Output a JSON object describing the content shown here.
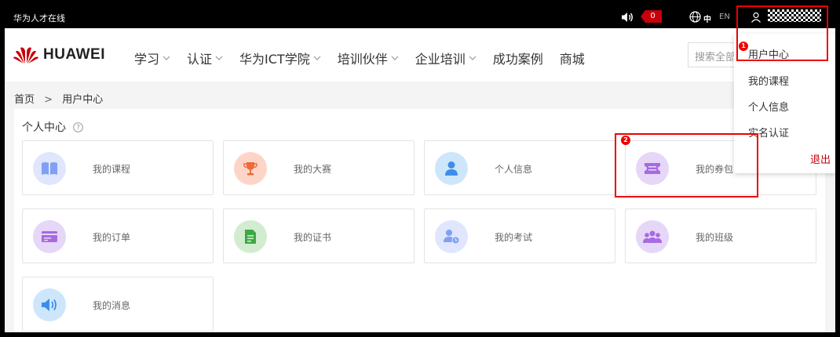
{
  "topbar": {
    "site_name": "华为人才在线",
    "notification_count": "0",
    "lang_zh": "中",
    "lang_en": "EN"
  },
  "header": {
    "logo_text": "HUAWEI",
    "nav": [
      {
        "label": "学习",
        "has_dropdown": true
      },
      {
        "label": "认证",
        "has_dropdown": true
      },
      {
        "label": "华为ICT学院",
        "has_dropdown": true
      },
      {
        "label": "培训伙伴",
        "has_dropdown": true
      },
      {
        "label": "企业培训",
        "has_dropdown": true
      },
      {
        "label": "成功案例",
        "has_dropdown": false
      },
      {
        "label": "商城",
        "has_dropdown": false
      }
    ],
    "search_placeholder": "搜索全部"
  },
  "breadcrumb": {
    "home": "首页",
    "separator": ">",
    "current": "用户中心"
  },
  "panel": {
    "title": "个人中心",
    "cards": [
      {
        "label": "我的课程",
        "icon": "book-icon",
        "bg": "#dfe6fd",
        "fg": "#7fa0f3"
      },
      {
        "label": "我的大赛",
        "icon": "trophy-icon",
        "bg": "#fdd5c8",
        "fg": "#ec6a3b"
      },
      {
        "label": "个人信息",
        "icon": "person-icon",
        "bg": "#cde6fb",
        "fg": "#3e8ee8"
      },
      {
        "label": "我的券包",
        "icon": "ticket-icon",
        "bg": "#e6d6f7",
        "fg": "#a56be0"
      },
      {
        "label": "我的订单",
        "icon": "order-icon",
        "bg": "#e6d6f7",
        "fg": "#a56be0"
      },
      {
        "label": "我的证书",
        "icon": "certificate-icon",
        "bg": "#d2ecd0",
        "fg": "#3ea845"
      },
      {
        "label": "我的考试",
        "icon": "exam-icon",
        "bg": "#dfe6fd",
        "fg": "#7fa0f3"
      },
      {
        "label": "我的班级",
        "icon": "class-icon",
        "bg": "#e6d6f7",
        "fg": "#a56be0"
      },
      {
        "label": "我的消息",
        "icon": "message-icon",
        "bg": "#cde6fb",
        "fg": "#3e8ee8"
      }
    ]
  },
  "dropdown": {
    "items": [
      "用户中心",
      "我的课程",
      "个人信息",
      "实名认证"
    ],
    "logout": "退出"
  },
  "annotations": {
    "step1": "1",
    "step2": "2"
  },
  "colors": {
    "brand_red": "#c7000b",
    "annotation_red": "#e00000"
  }
}
